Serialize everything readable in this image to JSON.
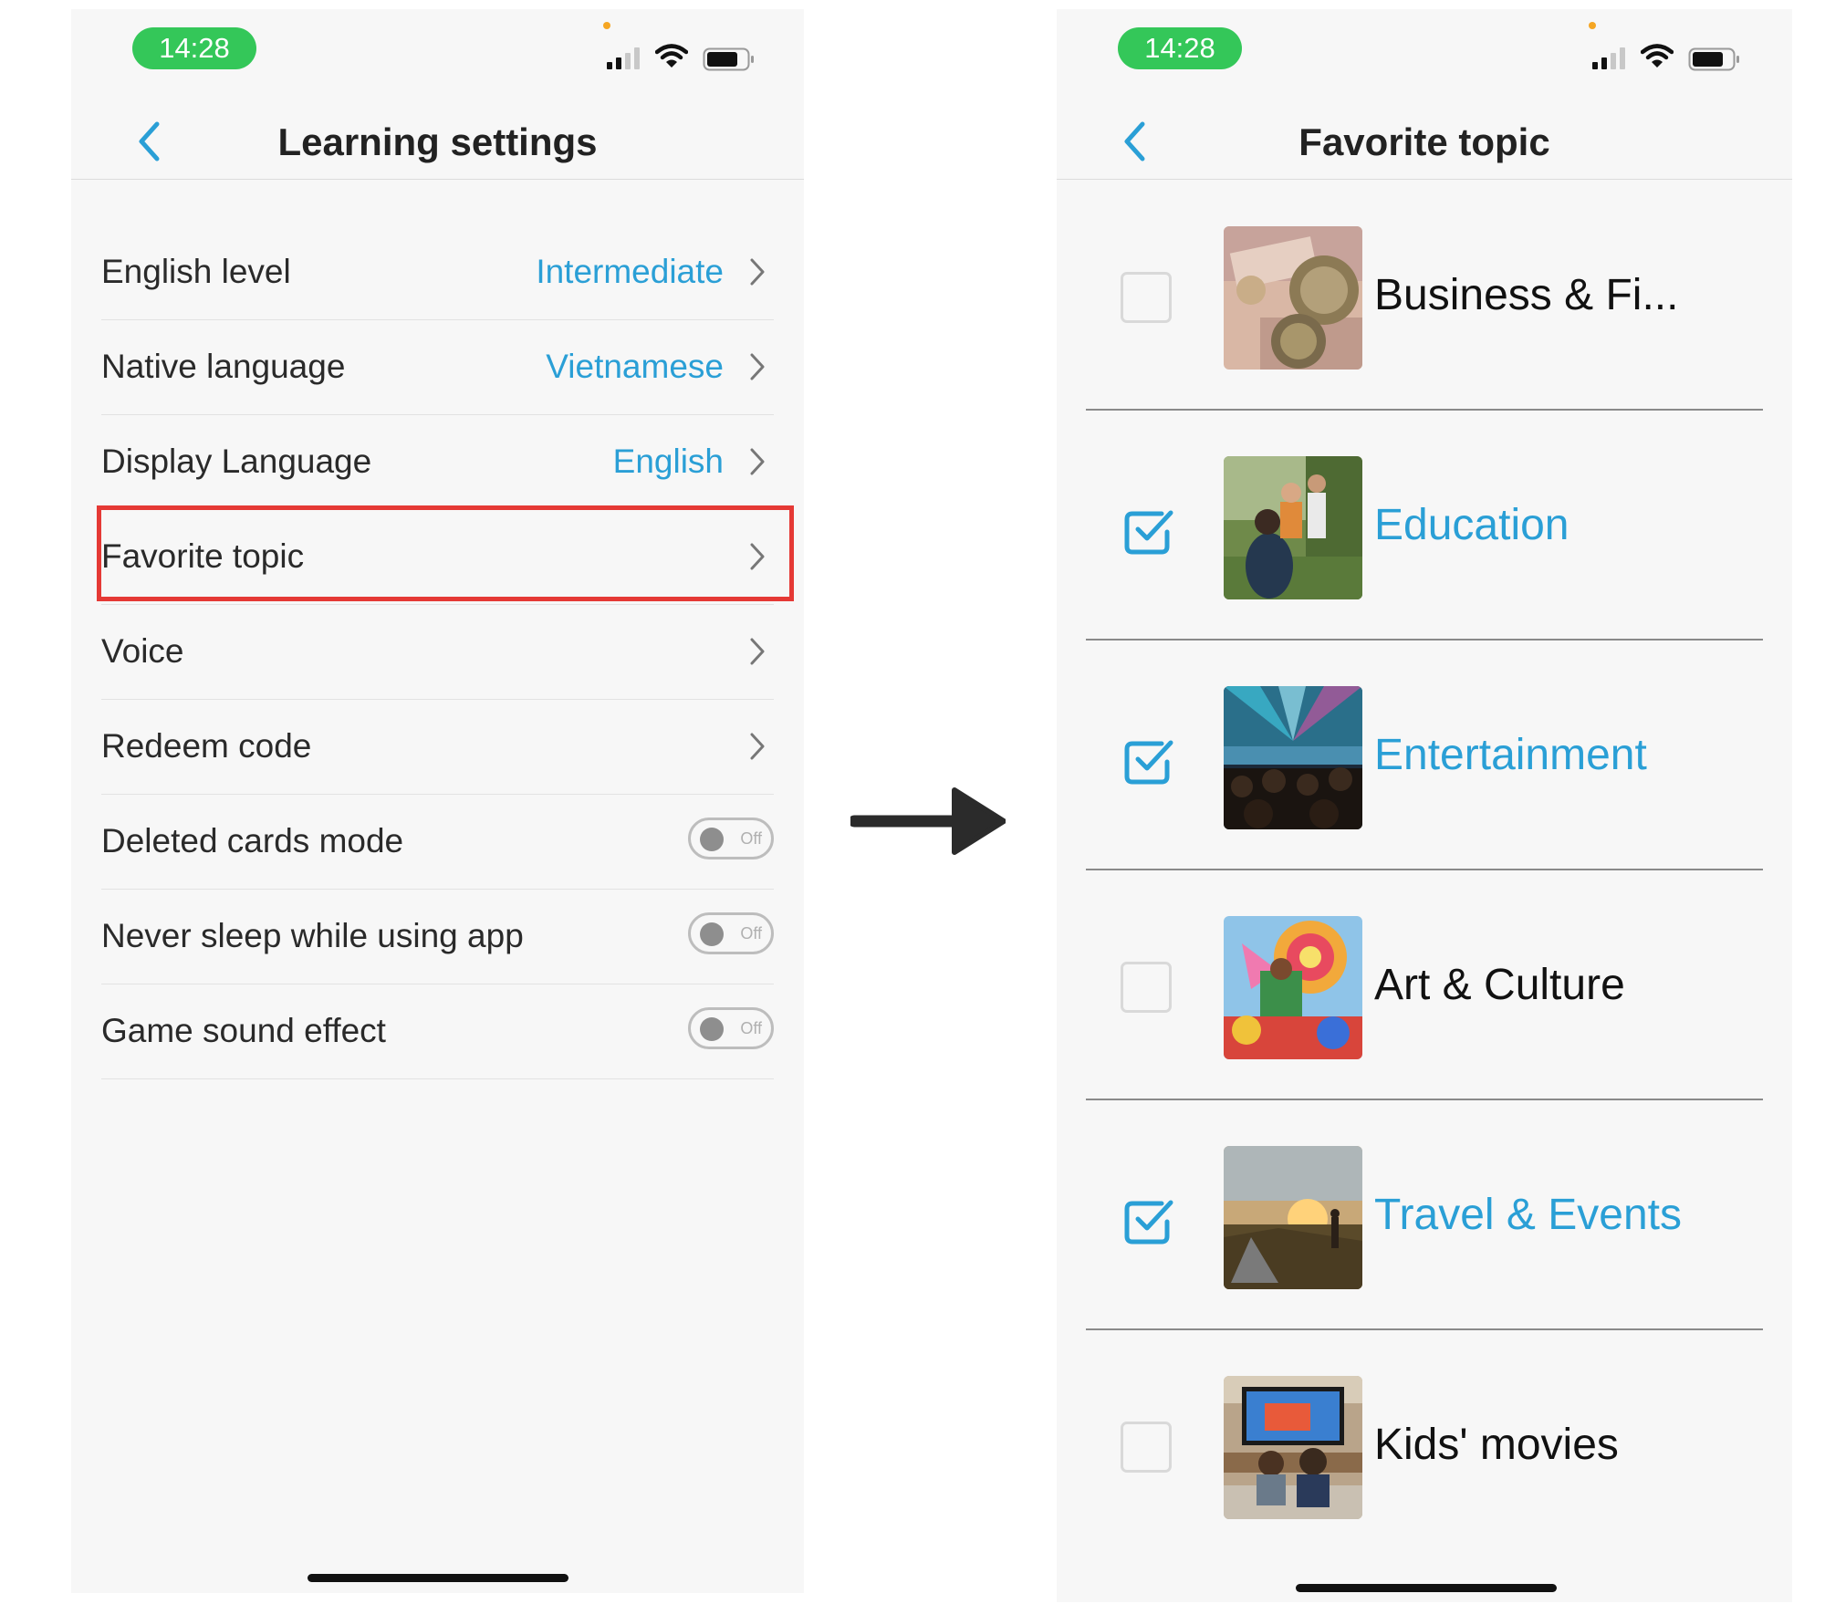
{
  "settings_screen": {
    "status_time": "14:28",
    "title": "Learning settings",
    "back_icon": "chevron-left-icon",
    "rows": [
      {
        "label": "English level",
        "value": "Intermediate",
        "control": "chevron"
      },
      {
        "label": "Native language",
        "value": "Vietnamese",
        "control": "chevron"
      },
      {
        "label": "Display Language",
        "value": "English",
        "control": "chevron"
      },
      {
        "label": "Favorite topic",
        "value": "",
        "control": "chevron",
        "highlighted": true
      },
      {
        "label": "Voice",
        "value": "",
        "control": "chevron"
      },
      {
        "label": "Redeem code",
        "value": "",
        "control": "chevron"
      },
      {
        "label": "Deleted cards mode",
        "control": "toggle",
        "toggle_text": "Off",
        "on": false
      },
      {
        "label": "Never sleep while using app",
        "control": "toggle",
        "toggle_text": "Off",
        "on": false
      },
      {
        "label": "Game sound effect",
        "control": "toggle",
        "toggle_text": "Off",
        "on": false
      }
    ]
  },
  "topics_screen": {
    "status_time": "14:28",
    "title": "Favorite topic",
    "back_icon": "chevron-left-icon",
    "topics": [
      {
        "label": "Business & Fi...",
        "checked": false,
        "thumb": "coins-photo"
      },
      {
        "label": "Education",
        "checked": true,
        "thumb": "family-park-photo"
      },
      {
        "label": "Entertainment",
        "checked": true,
        "thumb": "concert-crowd-photo"
      },
      {
        "label": "Art & Culture",
        "checked": false,
        "thumb": "festival-costume-photo"
      },
      {
        "label": "Travel & Events",
        "checked": true,
        "thumb": "sunset-camping-photo"
      },
      {
        "label": "Kids' movies",
        "checked": false,
        "thumb": "kids-watching-tv-photo"
      }
    ]
  },
  "colors": {
    "accent": "#2a9fd6",
    "status_pill": "#34c759",
    "highlight_border": "#e53935",
    "screen_bg": "#f7f7f7"
  },
  "flow_icon": "arrow-right-icon"
}
